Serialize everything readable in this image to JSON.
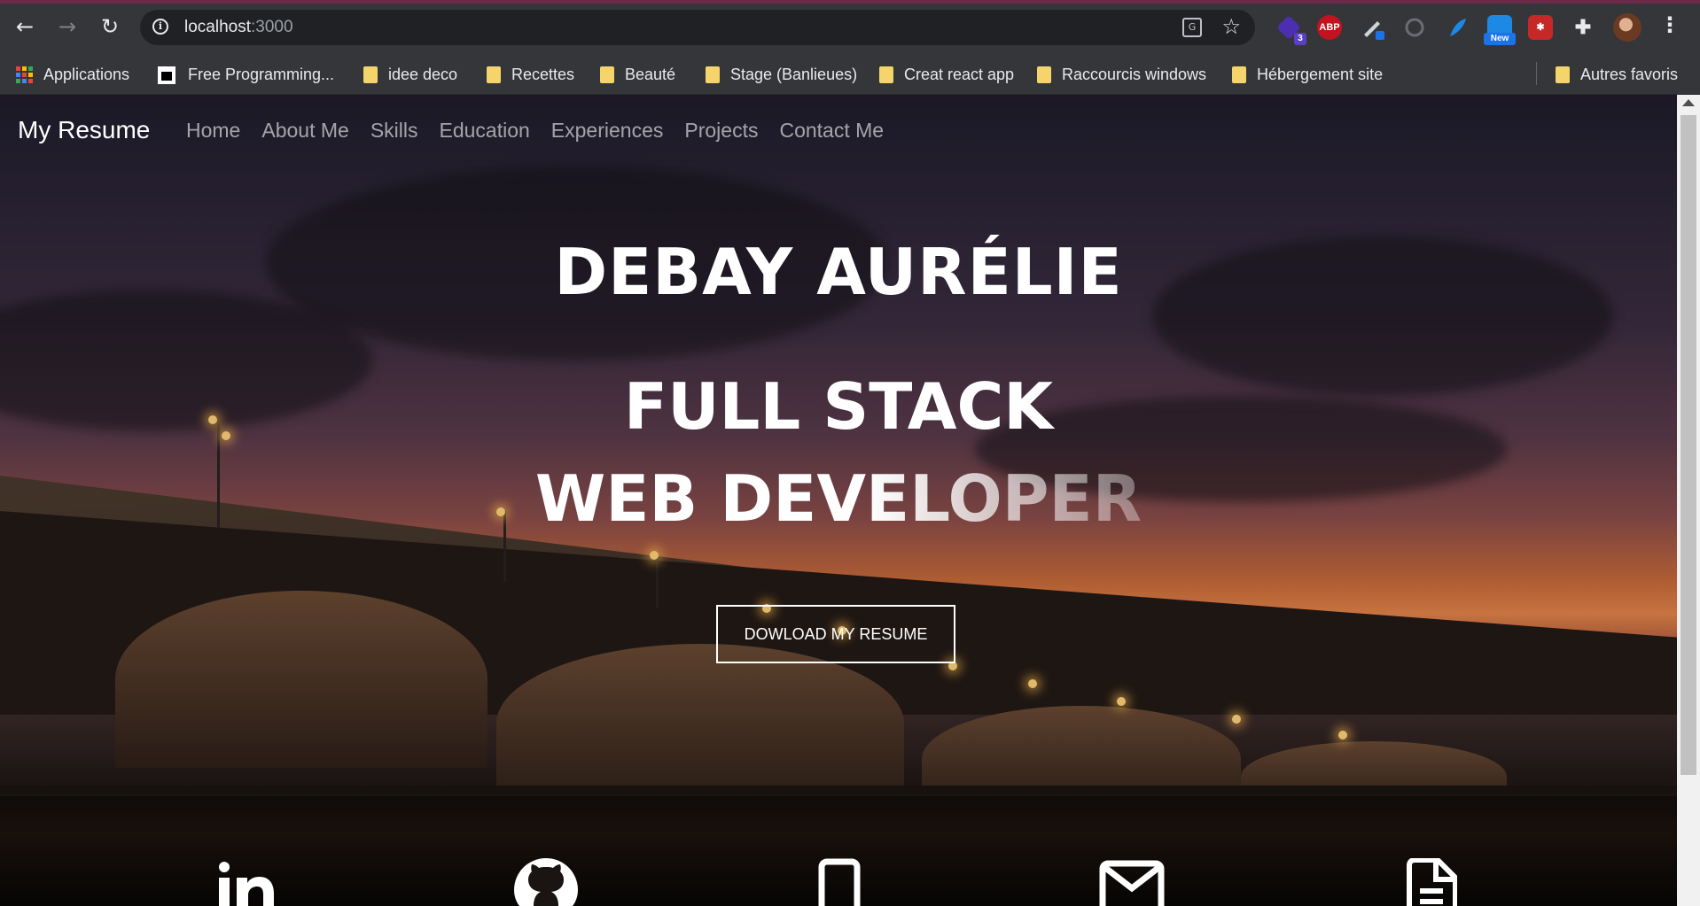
{
  "browser": {
    "url_host": "localhost",
    "url_port": ":3000",
    "extensions": [
      {
        "name": "extension-icon",
        "badge": "3"
      },
      {
        "name": "adblock-icon",
        "label": "ABP"
      },
      {
        "name": "pen-extension-icon"
      },
      {
        "name": "timer-extension-icon"
      },
      {
        "name": "feather-extension-icon"
      },
      {
        "name": "screenshot-extension-icon",
        "badge": "New"
      },
      {
        "name": "bug-extension-icon"
      },
      {
        "name": "puzzle-icon"
      }
    ],
    "bookmarks": [
      {
        "label": "Applications"
      },
      {
        "label": "Free Programming..."
      },
      {
        "label": "idee deco"
      },
      {
        "label": "Recettes"
      },
      {
        "label": "Beauté"
      },
      {
        "label": "Stage (Banlieues)"
      },
      {
        "label": "Creat react app"
      },
      {
        "label": "Raccourcis windows"
      },
      {
        "label": "Hébergement site"
      },
      {
        "label": "Autres favoris"
      }
    ]
  },
  "site": {
    "brand": "My Resume",
    "nav": [
      "Home",
      "About Me",
      "Skills",
      "Education",
      "Experiences",
      "Projects",
      "Contact Me"
    ],
    "hero": {
      "name": "DEBAY AURÉLIE",
      "role_line1": "FULL STACK",
      "role_line2": "WEB DEVELOPER",
      "button": "DOWLOAD MY RESUME"
    },
    "social": [
      "linkedin-icon",
      "github-icon",
      "phone-icon",
      "mail-icon",
      "document-icon"
    ]
  }
}
